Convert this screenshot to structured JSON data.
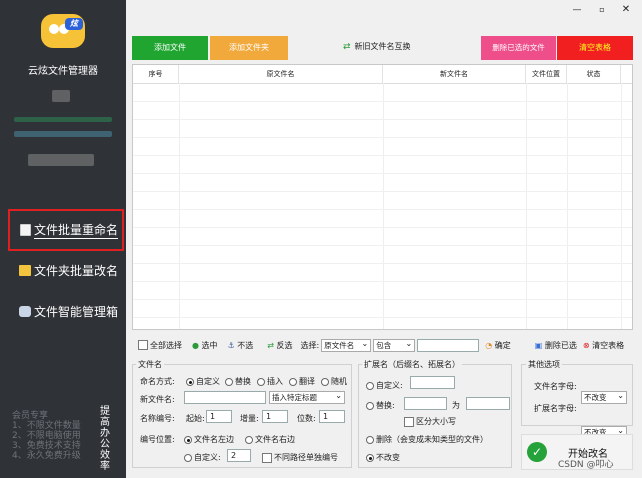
{
  "app": {
    "name": "云炫文件管理器",
    "logo_badge": "炫",
    "window": {
      "minimize": "—",
      "maximize": "▫",
      "close": "✕"
    }
  },
  "sidebar": {
    "items": [
      {
        "label": "文件批量重命名",
        "icon": "document-icon",
        "active": true
      },
      {
        "label": "文件夹批量改名",
        "icon": "folder-icon",
        "active": false
      },
      {
        "label": "文件智能管理箱",
        "icon": "gamepad-icon",
        "active": false
      }
    ],
    "promo_left": [
      "会员专享",
      "1、不限文件数量",
      "2、不限电脑使用",
      "3、免费技术支持",
      "4、永久免费升级"
    ],
    "promo_right": "提高办公效率"
  },
  "toolbar": {
    "add_file": "添加文件",
    "add_folder": "添加文件夹",
    "swap": "新旧文件名互换",
    "delete_selected": "删除已选的文件",
    "clear_table": "清空表格"
  },
  "table": {
    "headers": [
      "序号",
      "原文件名",
      "新文件名",
      "文件位置",
      "状态"
    ]
  },
  "filter": {
    "select_all": "全部选择",
    "select": "选中",
    "deselect": "不选",
    "invert": "反选",
    "choose_label": "选择:",
    "field": "原文件名",
    "condition": "包含",
    "value": "",
    "confirm": "确定",
    "delete_selected": "删除已选",
    "clear_table": "清空表格"
  },
  "filename_group": {
    "title": "文件名",
    "mode_label": "命名方式:",
    "modes": [
      "自定义",
      "替换",
      "插入",
      "翻译",
      "随机"
    ],
    "mode_selected": "自定义",
    "new_name_label": "新文件名:",
    "new_name_value": "",
    "insert_special": "插入特定标题",
    "number_label": "名称编号:",
    "start_label": "起始:",
    "start_value": "1",
    "increment_label": "增量:",
    "increment_value": "1",
    "digits_label": "位数:",
    "digits_value": "1",
    "position_label": "编号位置:",
    "pos_left": "文件名左边",
    "pos_right": "文件名右边",
    "pos_custom": "自定义:",
    "pos_custom_value": "2",
    "separate_path": "不同路径单独编号"
  },
  "ext_group": {
    "title": "扩展名（后缀名、拓展名）",
    "custom": "自定义:",
    "custom_value": "",
    "replace": "替换:",
    "replace_from": "",
    "to_label": "为",
    "replace_to": "",
    "case_sensitive": "区分大小写",
    "delete": "删除（会变成未知类型的文件）",
    "unchanged": "不改变"
  },
  "other_group": {
    "title": "其他选项",
    "filename_case_label": "文件名字母:",
    "filename_case_value": "不改变",
    "ext_case_label": "扩展名字母:",
    "ext_case_value": "不改变"
  },
  "start": {
    "label": "开始改名"
  },
  "watermark": "CSDN @叩心"
}
